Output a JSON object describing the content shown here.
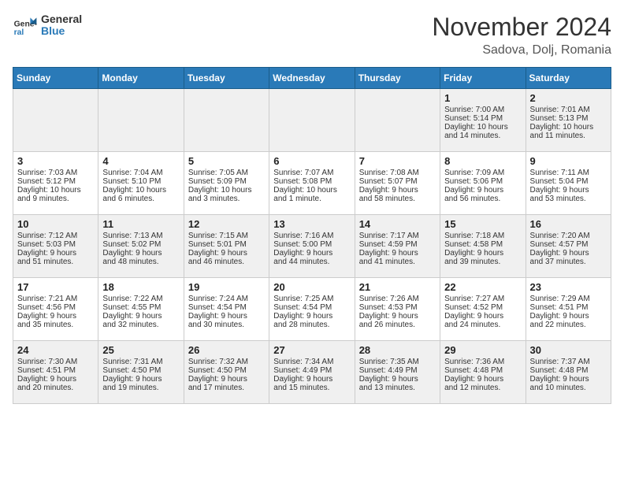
{
  "header": {
    "logo_general": "General",
    "logo_blue": "Blue",
    "title": "November 2024",
    "location": "Sadova, Dolj, Romania"
  },
  "days_of_week": [
    "Sunday",
    "Monday",
    "Tuesday",
    "Wednesday",
    "Thursday",
    "Friday",
    "Saturday"
  ],
  "weeks": [
    [
      {
        "day": "",
        "info": ""
      },
      {
        "day": "",
        "info": ""
      },
      {
        "day": "",
        "info": ""
      },
      {
        "day": "",
        "info": ""
      },
      {
        "day": "",
        "info": ""
      },
      {
        "day": "1",
        "info": "Sunrise: 7:00 AM\nSunset: 5:14 PM\nDaylight: 10 hours\nand 14 minutes."
      },
      {
        "day": "2",
        "info": "Sunrise: 7:01 AM\nSunset: 5:13 PM\nDaylight: 10 hours\nand 11 minutes."
      }
    ],
    [
      {
        "day": "3",
        "info": "Sunrise: 7:03 AM\nSunset: 5:12 PM\nDaylight: 10 hours\nand 9 minutes."
      },
      {
        "day": "4",
        "info": "Sunrise: 7:04 AM\nSunset: 5:10 PM\nDaylight: 10 hours\nand 6 minutes."
      },
      {
        "day": "5",
        "info": "Sunrise: 7:05 AM\nSunset: 5:09 PM\nDaylight: 10 hours\nand 3 minutes."
      },
      {
        "day": "6",
        "info": "Sunrise: 7:07 AM\nSunset: 5:08 PM\nDaylight: 10 hours\nand 1 minute."
      },
      {
        "day": "7",
        "info": "Sunrise: 7:08 AM\nSunset: 5:07 PM\nDaylight: 9 hours\nand 58 minutes."
      },
      {
        "day": "8",
        "info": "Sunrise: 7:09 AM\nSunset: 5:06 PM\nDaylight: 9 hours\nand 56 minutes."
      },
      {
        "day": "9",
        "info": "Sunrise: 7:11 AM\nSunset: 5:04 PM\nDaylight: 9 hours\nand 53 minutes."
      }
    ],
    [
      {
        "day": "10",
        "info": "Sunrise: 7:12 AM\nSunset: 5:03 PM\nDaylight: 9 hours\nand 51 minutes."
      },
      {
        "day": "11",
        "info": "Sunrise: 7:13 AM\nSunset: 5:02 PM\nDaylight: 9 hours\nand 48 minutes."
      },
      {
        "day": "12",
        "info": "Sunrise: 7:15 AM\nSunset: 5:01 PM\nDaylight: 9 hours\nand 46 minutes."
      },
      {
        "day": "13",
        "info": "Sunrise: 7:16 AM\nSunset: 5:00 PM\nDaylight: 9 hours\nand 44 minutes."
      },
      {
        "day": "14",
        "info": "Sunrise: 7:17 AM\nSunset: 4:59 PM\nDaylight: 9 hours\nand 41 minutes."
      },
      {
        "day": "15",
        "info": "Sunrise: 7:18 AM\nSunset: 4:58 PM\nDaylight: 9 hours\nand 39 minutes."
      },
      {
        "day": "16",
        "info": "Sunrise: 7:20 AM\nSunset: 4:57 PM\nDaylight: 9 hours\nand 37 minutes."
      }
    ],
    [
      {
        "day": "17",
        "info": "Sunrise: 7:21 AM\nSunset: 4:56 PM\nDaylight: 9 hours\nand 35 minutes."
      },
      {
        "day": "18",
        "info": "Sunrise: 7:22 AM\nSunset: 4:55 PM\nDaylight: 9 hours\nand 32 minutes."
      },
      {
        "day": "19",
        "info": "Sunrise: 7:24 AM\nSunset: 4:54 PM\nDaylight: 9 hours\nand 30 minutes."
      },
      {
        "day": "20",
        "info": "Sunrise: 7:25 AM\nSunset: 4:54 PM\nDaylight: 9 hours\nand 28 minutes."
      },
      {
        "day": "21",
        "info": "Sunrise: 7:26 AM\nSunset: 4:53 PM\nDaylight: 9 hours\nand 26 minutes."
      },
      {
        "day": "22",
        "info": "Sunrise: 7:27 AM\nSunset: 4:52 PM\nDaylight: 9 hours\nand 24 minutes."
      },
      {
        "day": "23",
        "info": "Sunrise: 7:29 AM\nSunset: 4:51 PM\nDaylight: 9 hours\nand 22 minutes."
      }
    ],
    [
      {
        "day": "24",
        "info": "Sunrise: 7:30 AM\nSunset: 4:51 PM\nDaylight: 9 hours\nand 20 minutes."
      },
      {
        "day": "25",
        "info": "Sunrise: 7:31 AM\nSunset: 4:50 PM\nDaylight: 9 hours\nand 19 minutes."
      },
      {
        "day": "26",
        "info": "Sunrise: 7:32 AM\nSunset: 4:50 PM\nDaylight: 9 hours\nand 17 minutes."
      },
      {
        "day": "27",
        "info": "Sunrise: 7:34 AM\nSunset: 4:49 PM\nDaylight: 9 hours\nand 15 minutes."
      },
      {
        "day": "28",
        "info": "Sunrise: 7:35 AM\nSunset: 4:49 PM\nDaylight: 9 hours\nand 13 minutes."
      },
      {
        "day": "29",
        "info": "Sunrise: 7:36 AM\nSunset: 4:48 PM\nDaylight: 9 hours\nand 12 minutes."
      },
      {
        "day": "30",
        "info": "Sunrise: 7:37 AM\nSunset: 4:48 PM\nDaylight: 9 hours\nand 10 minutes."
      }
    ]
  ]
}
